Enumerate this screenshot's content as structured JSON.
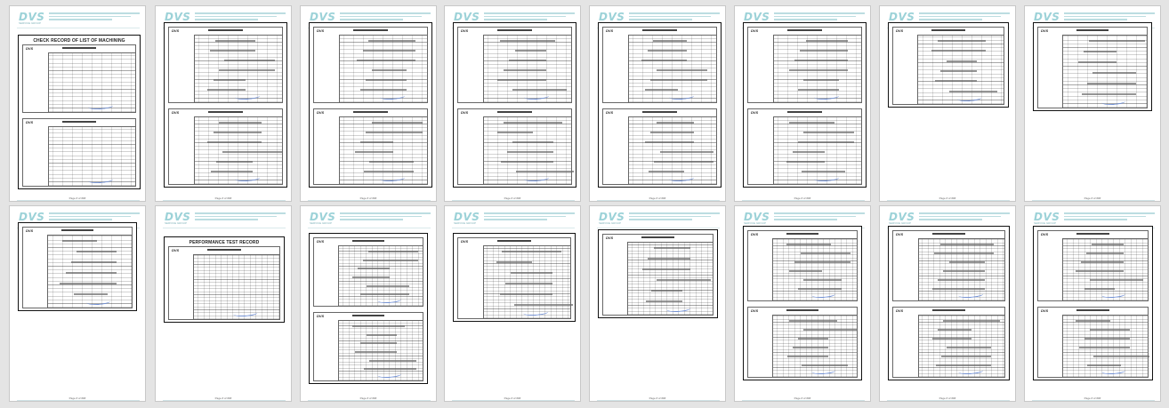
{
  "header": {
    "logo": "DVS",
    "logo_sub": "SERVICE GROUP"
  },
  "footer_text": "",
  "page_label": "Page # of ###",
  "pages": [
    {
      "title": "CHECK RECORD OF LIST OF MACHINING",
      "forms": 2,
      "handwritten": false
    },
    {
      "title": "",
      "forms": 2,
      "handwritten": true
    },
    {
      "title": "",
      "forms": 2,
      "handwritten": true
    },
    {
      "title": "",
      "forms": 2,
      "handwritten": true
    },
    {
      "title": "",
      "forms": 2,
      "handwritten": true
    },
    {
      "title": "",
      "forms": 2,
      "handwritten": true
    },
    {
      "title": "",
      "forms": 1,
      "handwritten": true
    },
    {
      "title": "",
      "forms": 1,
      "handwritten": true
    },
    {
      "title": "",
      "forms": 1,
      "handwritten": true
    },
    {
      "title": "PERFORMANCE TEST RECORD",
      "forms": 1,
      "handwritten": false
    },
    {
      "title": "",
      "forms": 2,
      "handwritten": true
    },
    {
      "title": "",
      "forms": 1,
      "handwritten": true
    },
    {
      "title": "",
      "forms": 1,
      "handwritten": true
    },
    {
      "title": "",
      "forms": 2,
      "handwritten": true
    },
    {
      "title": "",
      "forms": 2,
      "handwritten": true
    },
    {
      "title": "",
      "forms": 2,
      "handwritten": true
    }
  ]
}
